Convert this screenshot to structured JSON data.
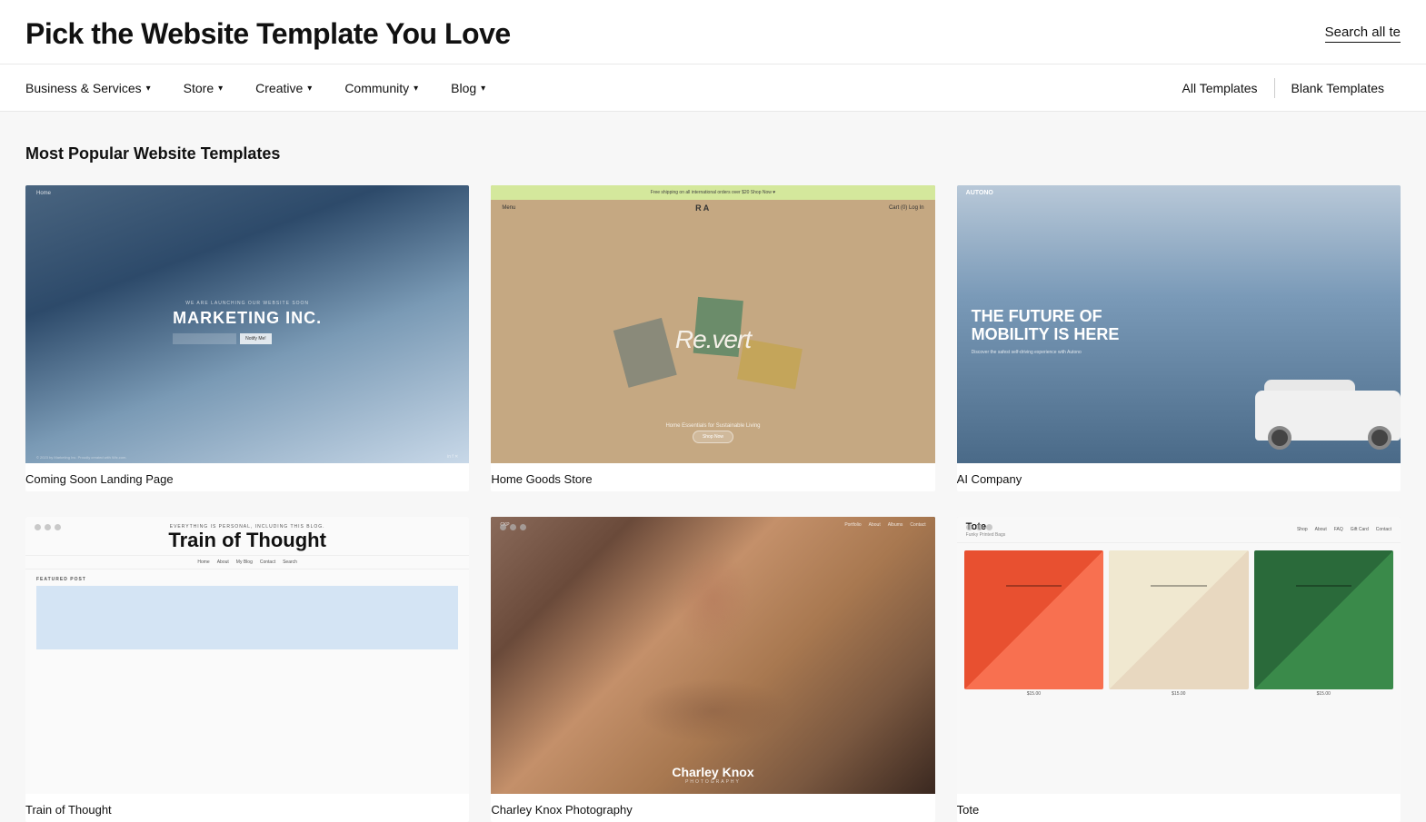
{
  "header": {
    "title": "Pick the Website Template You Love",
    "search_label": "Search all te"
  },
  "nav": {
    "left_items": [
      {
        "id": "business-services",
        "label": "Business & Services"
      },
      {
        "id": "store",
        "label": "Store"
      },
      {
        "id": "creative",
        "label": "Creative"
      },
      {
        "id": "community",
        "label": "Community"
      },
      {
        "id": "blog",
        "label": "Blog"
      }
    ],
    "right_items": [
      {
        "id": "all-templates",
        "label": "All Templates"
      },
      {
        "id": "blank-templates",
        "label": "Blank Templates"
      }
    ]
  },
  "main": {
    "section_title": "Most Popular Website Templates",
    "templates": [
      {
        "id": "coming-soon",
        "name": "Coming Soon Landing Page",
        "preview_label": "MARKETING INC.",
        "eyebrow": "WE ARE LAUNCHING OUR WEBSITE SOON"
      },
      {
        "id": "home-goods",
        "name": "Home Goods Store",
        "preview_label": "Re.vert",
        "subtitle": "Home Essentials for Sustainable Living",
        "btn_label": "Shop Now"
      },
      {
        "id": "ai-company",
        "name": "AI Company",
        "preview_label": "AUTONO",
        "heading_line1": "THE FUTURE OF",
        "heading_line2": "MOBILITY IS HERE"
      },
      {
        "id": "train-of-thought",
        "name": "Train of Thought",
        "eyebrow": "EVERYTHING IS PERSONAL, INCLUDING THIS BLOG.",
        "blog_featured": "FEATURED POST"
      },
      {
        "id": "charley-knox",
        "name": "Charley Knox Photography",
        "photographer_name": "Charley Knox",
        "photographer_sub": "PHOTOGRAPHY"
      },
      {
        "id": "tote-store",
        "name": "Tote",
        "brand": "Tote",
        "brand_sub": "Funky Printed Bags",
        "products": [
          {
            "price": "$15.00"
          },
          {
            "price": "$15.00"
          },
          {
            "price": "$15.00"
          }
        ]
      }
    ]
  }
}
